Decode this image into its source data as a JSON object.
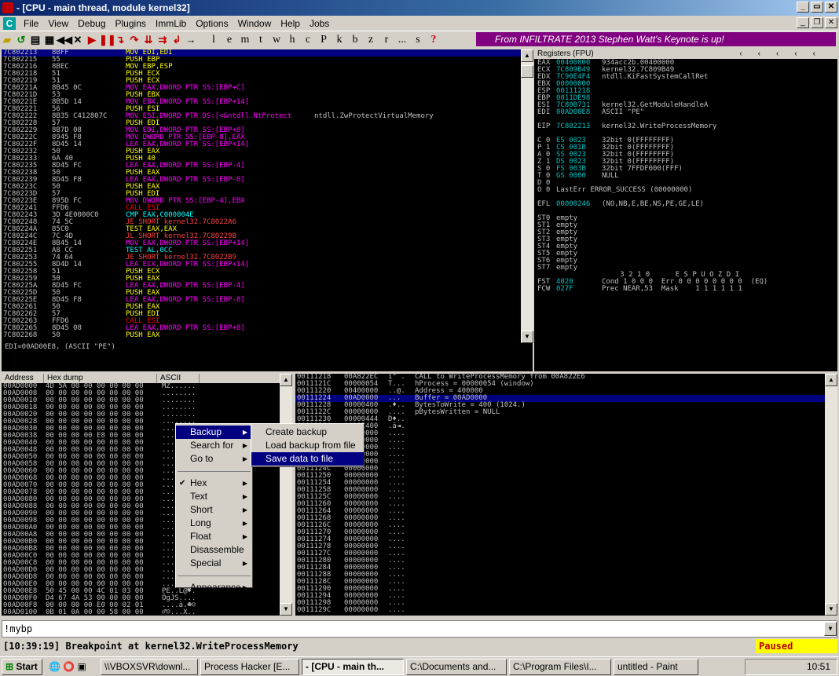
{
  "window": {
    "title": "- [CPU - main thread, module kernel32]"
  },
  "menu": [
    "File",
    "View",
    "Debug",
    "Plugins",
    "ImmLib",
    "Options",
    "Window",
    "Help",
    "Jobs"
  ],
  "toolbar_letters": [
    "l",
    "e",
    "m",
    "t",
    "w",
    "h",
    "c",
    "P",
    "k",
    "b",
    "z",
    "r",
    "...",
    "s",
    "?"
  ],
  "banner": "From INFILTRATE 2013 Stephen Watt's Keynote is up!",
  "disasm": [
    {
      "a": "7C802213",
      "h": "8BFF",
      "i": "MOV EDI,EDI",
      "c": "#ffff00"
    },
    {
      "a": "7C802215",
      "h": "55",
      "i": "PUSH EBP",
      "c": "#ffff00"
    },
    {
      "a": "7C802216",
      "h": "8BEC",
      "i": "MOV EBP,ESP",
      "c": "#ffff00"
    },
    {
      "a": "7C802218",
      "h": "51",
      "i": "PUSH ECX",
      "c": "#ffff00"
    },
    {
      "a": "7C802219",
      "h": "51",
      "i": "PUSH ECX",
      "c": "#ffff00"
    },
    {
      "a": "7C80221A",
      "h": "8B45 0C",
      "i": "MOV EAX,DWORD PTR SS:[EBP+C]",
      "c": "#ff00ff"
    },
    {
      "a": "7C80221D",
      "h": "53",
      "i": "PUSH EBX",
      "c": "#ffff00"
    },
    {
      "a": "7C80221E",
      "h": "8B5D 14",
      "i": "MOV EBX,DWORD PTR SS:[EBP+14]",
      "c": "#ff00ff"
    },
    {
      "a": "7C802221",
      "h": "56",
      "i": "PUSH ESI",
      "c": "#ffff00"
    },
    {
      "a": "7C802222",
      "h": "8B35 C412807C",
      "i": "MOV ESI,DWORD PTR DS:[<&ntdll.NtProtect",
      "c": "#ff00ff",
      "cm": "ntdll.ZwProtectVirtualMemory"
    },
    {
      "a": "7C802228",
      "h": "57",
      "i": "PUSH EDI",
      "c": "#ffff00"
    },
    {
      "a": "7C802229",
      "h": "8B7D 08",
      "i": "MOV EDI,DWORD PTR SS:[EBP+8]",
      "c": "#ff00ff"
    },
    {
      "a": "7C80222C",
      "h": "8945 F8",
      "i": "MOV DWORD PTR SS:[EBP-8],EAX",
      "c": "#ff00ff"
    },
    {
      "a": "7C80222F",
      "h": "8D45 14",
      "i": "LEA EAX,DWORD PTR SS:[EBP+14]",
      "c": "#ff00ff"
    },
    {
      "a": "7C802232",
      "h": "50",
      "i": "PUSH EAX",
      "c": "#ffff00"
    },
    {
      "a": "7C802233",
      "h": "6A 40",
      "i": "PUSH 40",
      "c": "#ffff00"
    },
    {
      "a": "7C802235",
      "h": "8D45 FC",
      "i": "LEA EAX,DWORD PTR SS:[EBP-4]",
      "c": "#ff00ff"
    },
    {
      "a": "7C802238",
      "h": "50",
      "i": "PUSH EAX",
      "c": "#ffff00"
    },
    {
      "a": "7C802239",
      "h": "8D45 F8",
      "i": "LEA EAX,DWORD PTR SS:[EBP-8]",
      "c": "#ff00ff"
    },
    {
      "a": "7C80223C",
      "h": "50",
      "i": "PUSH EAX",
      "c": "#ffff00"
    },
    {
      "a": "7C80223D",
      "h": "57",
      "i": "PUSH EDI",
      "c": "#ffff00"
    },
    {
      "a": "7C80223E",
      "h": "895D FC",
      "i": "MOV DWORD PTR SS:[EBP-4],EBX",
      "c": "#ff00ff"
    },
    {
      "a": "7C802241",
      "h": "FFD6",
      "i": "CALL ESI",
      "c": "#ff0000"
    },
    {
      "a": "7C802243",
      "h": "3D 4E0000C0",
      "i": "CMP EAX,C000004E",
      "c": "#00ffff"
    },
    {
      "a": "7C802248",
      "h": "74 5C",
      "i": "JE SHORT kernel32.7C8022A6",
      "c": "#ff4040"
    },
    {
      "a": "7C80224A",
      "h": "85C0",
      "i": "TEST EAX,EAX",
      "c": "#ffff00"
    },
    {
      "a": "7C80224C",
      "h": "7C 4D",
      "i": "JL SHORT kernel32.7C80229B",
      "c": "#ff4040"
    },
    {
      "a": "7C80224E",
      "h": "8B45 14",
      "i": "MOV EAX,DWORD PTR SS:[EBP+14]",
      "c": "#ff00ff"
    },
    {
      "a": "7C802251",
      "h": "A8 CC",
      "i": "TEST AL,0CC",
      "c": "#00ffff"
    },
    {
      "a": "7C802253",
      "h": "74 64",
      "i": "JE SHORT kernel32.7C8022B9",
      "c": "#ff4040"
    },
    {
      "a": "7C802255",
      "h": "8D4D 14",
      "i": "LEA ECX,DWORD PTR SS:[EBP+14]",
      "c": "#ff00ff"
    },
    {
      "a": "7C802258",
      "h": "51",
      "i": "PUSH ECX",
      "c": "#ffff00"
    },
    {
      "a": "7C802259",
      "h": "50",
      "i": "PUSH EAX",
      "c": "#ffff00"
    },
    {
      "a": "7C80225A",
      "h": "8D45 FC",
      "i": "LEA EAX,DWORD PTR SS:[EBP-4]",
      "c": "#ff00ff"
    },
    {
      "a": "7C80225D",
      "h": "50",
      "i": "PUSH EAX",
      "c": "#ffff00"
    },
    {
      "a": "7C80225E",
      "h": "8D45 F8",
      "i": "LEA EAX,DWORD PTR SS:[EBP-8]",
      "c": "#ff00ff"
    },
    {
      "a": "7C802261",
      "h": "50",
      "i": "PUSH EAX",
      "c": "#ffff00"
    },
    {
      "a": "7C802262",
      "h": "57",
      "i": "PUSH EDI",
      "c": "#ffff00"
    },
    {
      "a": "7C802263",
      "h": "FFD6",
      "i": "CALL ESI",
      "c": "#ff0000"
    },
    {
      "a": "7C802265",
      "h": "8D45 08",
      "i": "LEA EAX,DWORD PTR SS:[EBP+8]",
      "c": "#ff00ff"
    },
    {
      "a": "7C802268",
      "h": "50",
      "i": "PUSH EAX",
      "c": "#ffff00"
    }
  ],
  "info": "EDI=00AD00E8, (ASCII \"PE\")",
  "registers": {
    "title": "Registers (FPU)",
    "lines": [
      [
        "EAX",
        "00400000",
        "934acc2b.00400000"
      ],
      [
        "ECX",
        "7C809B49",
        "kernel32.7C809B49"
      ],
      [
        "EDX",
        "7C90E4F4",
        "ntdll.KiFastSystemCallRet"
      ],
      [
        "EBX",
        "00000000",
        ""
      ],
      [
        "ESP",
        "00111218",
        ""
      ],
      [
        "EBP",
        "0011DE98",
        ""
      ],
      [
        "ESI",
        "7C80B731",
        "kernel32.GetModuleHandleA"
      ],
      [
        "EDI",
        "00AD00E8",
        "ASCII \"PE\""
      ],
      [
        "",
        "",
        " "
      ],
      [
        "EIP",
        "7C802213",
        "kernel32.WriteProcessMemory"
      ],
      [
        "",
        "",
        " "
      ],
      [
        "C 0",
        "ES 0023",
        "32bit 0(FFFFFFFF)"
      ],
      [
        "P 1",
        "CS 001B",
        "32bit 0(FFFFFFFF)"
      ],
      [
        "A 0",
        "SS 0023",
        "32bit 0(FFFFFFFF)"
      ],
      [
        "Z 1",
        "DS 0023",
        "32bit 0(FFFFFFFF)"
      ],
      [
        "S 0",
        "FS 003B",
        "32bit 7FFDF000(FFF)"
      ],
      [
        "T 0",
        "GS 0000",
        "NULL"
      ],
      [
        "D 0",
        "",
        ""
      ],
      [
        "O 0",
        "",
        "LastErr ERROR_SUCCESS (00000000)"
      ],
      [
        "",
        "",
        " "
      ],
      [
        "EFL",
        "00000246",
        "(NO,NB,E,BE,NS,PE,GE,LE)"
      ],
      [
        "",
        "",
        " "
      ],
      [
        "ST0",
        "",
        "empty"
      ],
      [
        "ST1",
        "",
        "empty"
      ],
      [
        "ST2",
        "",
        "empty"
      ],
      [
        "ST3",
        "",
        "empty"
      ],
      [
        "ST4",
        "",
        "empty"
      ],
      [
        "ST5",
        "",
        "empty"
      ],
      [
        "ST6",
        "",
        "empty"
      ],
      [
        "ST7",
        "",
        "empty"
      ],
      [
        "",
        "",
        "               3 2 1 0      E S P U O Z D I"
      ],
      [
        "FST",
        "4020",
        "Cond 1 0 0 0  Err 0 0 0 0 0 0 0 0  (EQ)"
      ],
      [
        "FCW",
        "027F",
        "Prec NEAR,53  Mask    1 1 1 1 1 1"
      ]
    ]
  },
  "dump": {
    "headers": [
      "Address",
      "Hex dump",
      "ASCII"
    ],
    "rows": [
      [
        "00AD0000",
        "4D 5A 00 00 00 00 00 00",
        "MZ......"
      ],
      [
        "00AD0008",
        "00 00 00 00 00 00 00 00",
        "........"
      ],
      [
        "00AD0010",
        "00 00 00 00 00 00 00 00",
        "........"
      ],
      [
        "00AD0018",
        "00 00 00 00 00 00 00 00",
        "........"
      ],
      [
        "00AD0020",
        "00 00 00 00 00 00 00 00",
        "........"
      ],
      [
        "00AD0028",
        "00 00 00 00 00 00 00 00",
        "........"
      ],
      [
        "00AD0030",
        "00 00 00 00 00 00 00 00",
        "........"
      ],
      [
        "00AD0038",
        "00 00 00 00 E8 00 00 00",
        "....è..."
      ],
      [
        "00AD0040",
        "00 00 00 00 00 00 00 00",
        "........"
      ],
      [
        "00AD0048",
        "00 00 00 00 00 00 00 00",
        "........"
      ],
      [
        "00AD0050",
        "00 00 00 00 00 00 00 00",
        "........"
      ],
      [
        "00AD0058",
        "00 00 00 00 00 00 00 00",
        "........"
      ],
      [
        "00AD0060",
        "00 00 00 00 00 00 00 00",
        "........"
      ],
      [
        "00AD0068",
        "00 00 00 00 00 00 00 00",
        "........"
      ],
      [
        "00AD0070",
        "00 00 00 00 00 00 00 00",
        "........"
      ],
      [
        "00AD0078",
        "00 00 00 00 00 00 00 00",
        "........"
      ],
      [
        "00AD0080",
        "00 00 00 00 00 00 00 00",
        "........"
      ],
      [
        "00AD0088",
        "00 00 00 00 00 00 00 00",
        "........"
      ],
      [
        "00AD0090",
        "00 00 00 00 00 00 00 00",
        "........"
      ],
      [
        "00AD0098",
        "00 00 00 00 00 00 00 00",
        "........"
      ],
      [
        "00AD00A0",
        "00 00 00 00 00 00 00 00",
        "........"
      ],
      [
        "00AD00A8",
        "00 00 00 00 00 00 00 00",
        "........"
      ],
      [
        "00AD00B0",
        "00 00 00 00 00 00 00 00",
        "........"
      ],
      [
        "00AD00B8",
        "00 00 00 00 00 00 00 00",
        "........"
      ],
      [
        "00AD00C0",
        "00 00 00 00 00 00 00 00",
        "........"
      ],
      [
        "00AD00C8",
        "00 00 00 00 00 00 00 00",
        "........"
      ],
      [
        "00AD00D0",
        "00 00 00 00 00 00 00 00",
        "........"
      ],
      [
        "00AD00D8",
        "00 00 00 00 00 00 00 00",
        "........"
      ],
      [
        "00AD00E0",
        "00 00 00 00 00 00 00 00",
        "........"
      ],
      [
        "00AD00E8",
        "50 45 00 00 4C 01 03 00",
        "PE..L@♥."
      ],
      [
        "00AD00F0",
        "D4 67 4A 53 00 00 00 00",
        "ÔgJS...."
      ],
      [
        "00AD00F8",
        "00 00 00 00 E0 00 02 01",
        "....à.☻☺"
      ],
      [
        "00AD0100",
        "0B 01 0A 00 00 58 00 00",
        "♂☺...X.."
      ]
    ]
  },
  "stack": {
    "rows": [
      [
        "00111218",
        "00A822EC",
        "ì\"¨.",
        "CALL to WriteProcessMemory from 00A822E6"
      ],
      [
        "0011121C",
        "00000054",
        "T...",
        "hProcess = 00000054 (window)"
      ],
      [
        "00111220",
        "00400000",
        "..@.",
        "Address = 400000"
      ],
      [
        "00111224",
        "00AD0000",
        "..­.",
        "Buffer = 00AD0000"
      ],
      [
        "00111228",
        "00000400",
        ".♦..",
        "BytesToWrite = 400 (1024.)"
      ],
      [
        "0011122C",
        "00000000",
        "....",
        "pBytesWritten = NULL"
      ],
      [
        "00111230",
        "00000444",
        "D♦.."
      ],
      [
        "00111234",
        "0011E400",
        ".ä◄."
      ],
      [
        "00111238",
        "00000000",
        "...."
      ],
      [
        "0011123C",
        "00000000",
        "...."
      ],
      [
        "00111240",
        "00000000",
        "...."
      ],
      [
        "00111244",
        "00000000",
        "...."
      ],
      [
        "00111248",
        "00000000",
        "...."
      ],
      [
        "0011124C",
        "00000000",
        "...."
      ],
      [
        "00111250",
        "00000000",
        "...."
      ],
      [
        "00111254",
        "00000000",
        "...."
      ],
      [
        "00111258",
        "00000000",
        "...."
      ],
      [
        "0011125C",
        "00000000",
        "...."
      ],
      [
        "00111260",
        "00000000",
        "...."
      ],
      [
        "00111264",
        "00000000",
        "...."
      ],
      [
        "00111268",
        "00000000",
        "...."
      ],
      [
        "0011126C",
        "00000000",
        "...."
      ],
      [
        "00111270",
        "00000000",
        "...."
      ],
      [
        "00111274",
        "00000000",
        "...."
      ],
      [
        "00111278",
        "00000000",
        "...."
      ],
      [
        "0011127C",
        "00000000",
        "...."
      ],
      [
        "00111280",
        "00000000",
        "...."
      ],
      [
        "00111284",
        "00000000",
        "...."
      ],
      [
        "00111288",
        "00000000",
        "...."
      ],
      [
        "0011128C",
        "00000000",
        "...."
      ],
      [
        "00111290",
        "00000000",
        "...."
      ],
      [
        "00111294",
        "00000000",
        "...."
      ],
      [
        "00111298",
        "00000000",
        "...."
      ],
      [
        "0011129C",
        "00000000",
        "...."
      ]
    ]
  },
  "context_menu": {
    "main": [
      "Backup",
      "Search for",
      "Go to",
      "Hex",
      "Text",
      "Short",
      "Long",
      "Float",
      "Disassemble",
      "Special",
      "Appearance"
    ],
    "sub": [
      "Create backup",
      "Load backup from file",
      "Save data to file"
    ]
  },
  "command": "!mybp",
  "status": {
    "message": "[10:39:19] Breakpoint at kernel32.WriteProcessMemory",
    "state": "Paused"
  },
  "taskbar": {
    "start": "Start",
    "tasks": [
      "\\\\VBOXSVR\\downl...",
      "Process Hacker [E...",
      "- [CPU - main th...",
      "C:\\Documents and...",
      "C:\\Program Files\\I...",
      "untitled - Paint"
    ],
    "clock": "10:51"
  }
}
